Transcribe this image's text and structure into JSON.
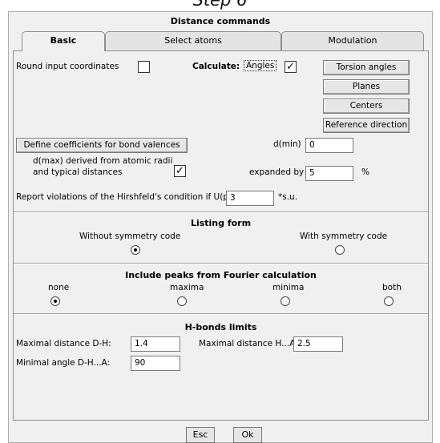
{
  "step_caption": "Step 6",
  "dialog": {
    "title": "Distance commands",
    "tabs": [
      {
        "label": "Basic"
      },
      {
        "label": "Select atoms"
      },
      {
        "label": "Modulation"
      }
    ]
  },
  "basic": {
    "round_label": "Round input coordinates",
    "round_checked": false,
    "calculate_label": "Calculate:",
    "angles_label": "Angles",
    "angles_checked": true,
    "buttons": {
      "torsion": "Torsion angles",
      "planes": "Planes",
      "centers": "Centers",
      "refdir": "Reference direction",
      "bond_valences": "Define coefficients for bond valences"
    },
    "dmin_label": "d(min)",
    "dmin_value": "0",
    "dmax_label_1": "d(max) derived from atomic radii",
    "dmax_label_2": "and typical distances",
    "dmax_checked": true,
    "expanded_label": "expanded by",
    "expanded_value": "5",
    "expanded_unit": "%",
    "hirshfeld_label": "Report violations of the Hirshfeld's condition if U(proj) >",
    "hirshfeld_value": "3",
    "hirshfeld_unit": "*s.u."
  },
  "listing": {
    "title": "Listing form",
    "without_label": "Without symmetry code",
    "with_label": "With symmetry code",
    "selected": "without"
  },
  "peaks": {
    "title": "Include peaks from Fourier calculation",
    "options": [
      "none",
      "maxima",
      "minima",
      "both"
    ],
    "selected": "none"
  },
  "hbonds": {
    "title": "H-bonds limits",
    "maxdist_dh_label": "Maximal distance D-H:",
    "maxdist_dh_value": "1.4",
    "maxdist_ha_label": "Maximal distance H...A:",
    "maxdist_ha_value": "2.5",
    "minangle_label": "Minimal angle D-H...A:",
    "minangle_value": "90"
  },
  "footer": {
    "esc_label": "Esc",
    "ok_label": "Ok"
  }
}
